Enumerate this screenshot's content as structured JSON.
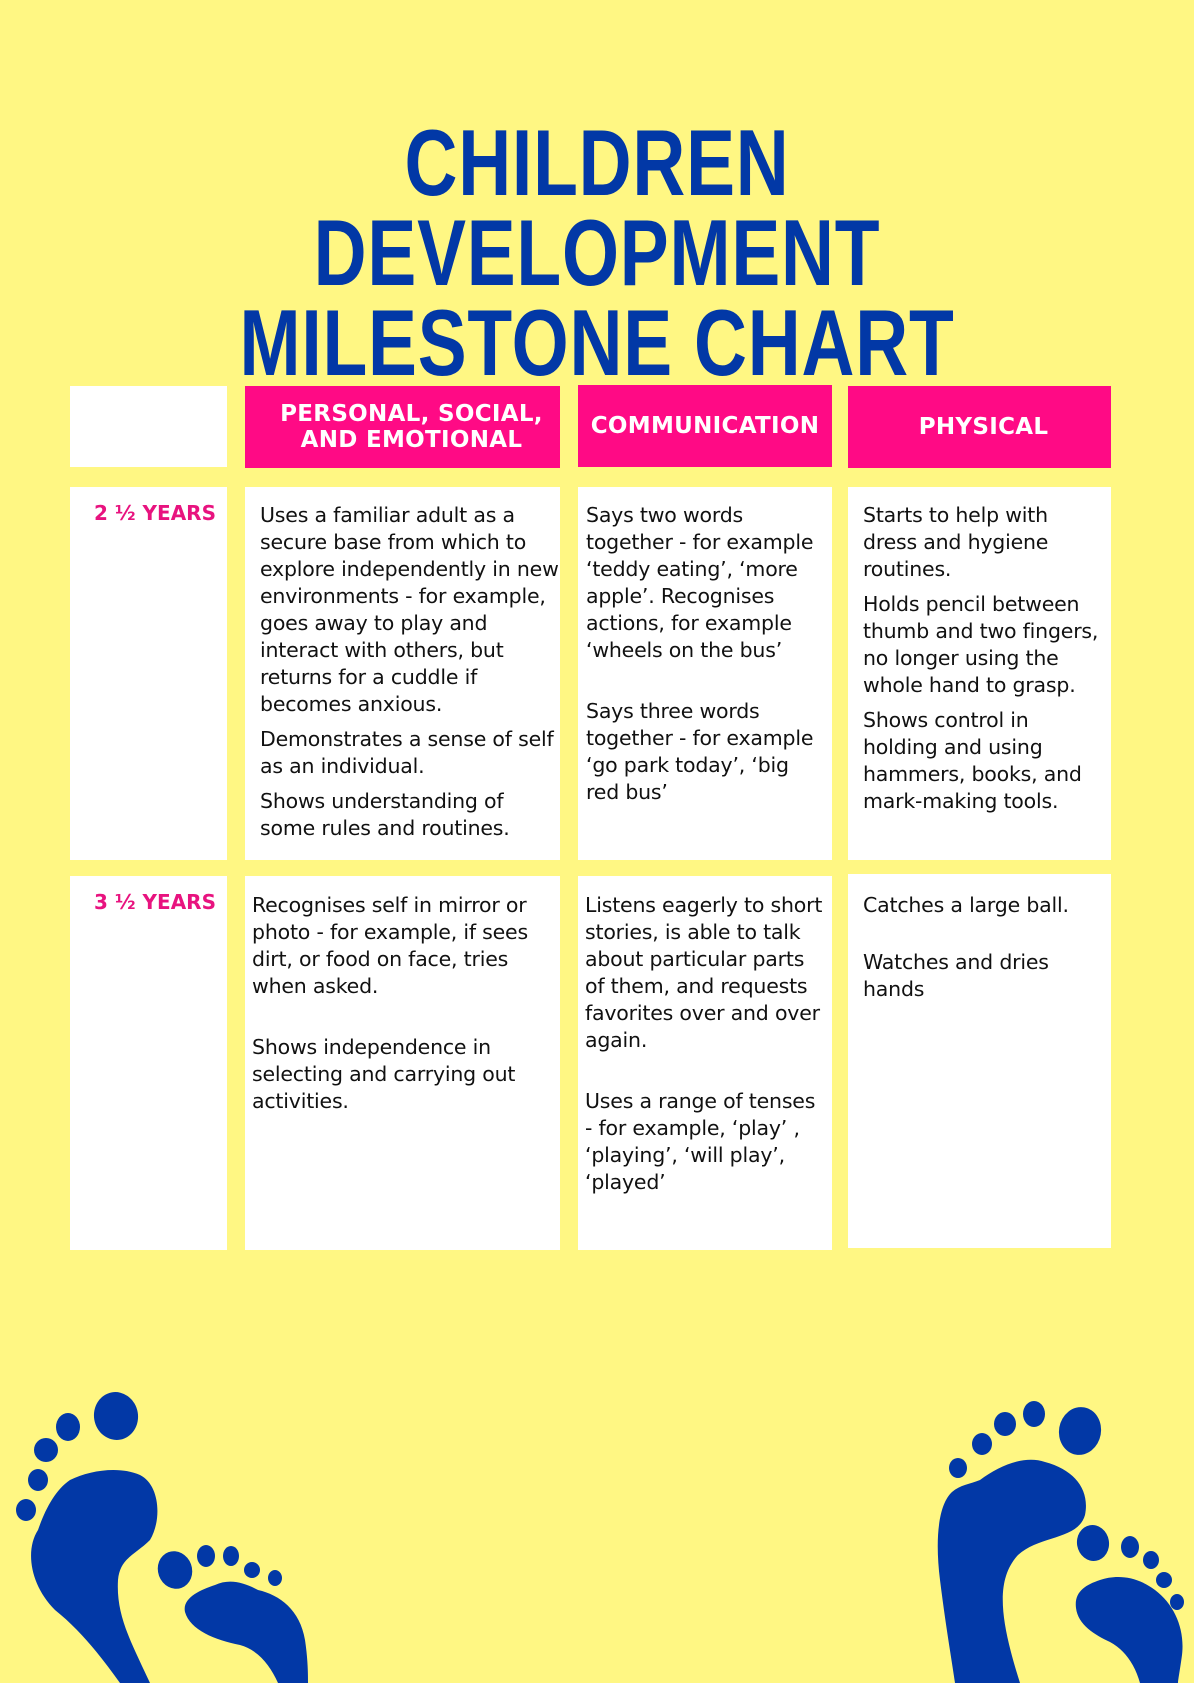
{
  "title": {
    "line1": "CHILDREN DEVELOPMENT",
    "line2": "MILESTONE CHART"
  },
  "colors": {
    "background": "#FFF783",
    "title_blue": "#0238A6",
    "header_pink": "#FF0A85",
    "age_pink": "#E8137F",
    "cell_white": "#FFFFFF"
  },
  "table": {
    "corner_header": "",
    "headers": [
      {
        "line1": "PERSONAL, SOCIAL,",
        "line2": "AND EMOTIONAL"
      },
      {
        "line1": "COMMUNICATION"
      },
      {
        "line1": "PHYSICAL"
      }
    ],
    "rows": [
      {
        "age": "2 ½ YEARS",
        "personal_social_emotional": [
          "Uses a familiar adult as a secure base from which to explore independently in new environments - for example, goes away to play and interact with others, but returns for a cuddle if becomes anxious.",
          "Demonstrates a sense of self as an individual.",
          "Shows understanding of some rules and routines."
        ],
        "communication": [
          "Says two words together - for example ‘teddy eating’, ‘more apple’. Recognises actions, for example ‘wheels on the bus’",
          "Says three words together - for example ‘go park today’, ‘big red bus’"
        ],
        "physical": [
          "Starts to help with dress and hygiene routines.",
          "Holds pencil between thumb and two fingers, no longer using the whole hand to grasp.",
          "Shows control in holding and using hammers, books, and mark-making tools."
        ]
      },
      {
        "age": "3 ½ YEARS",
        "personal_social_emotional": [
          "Recognises self in mirror or photo - for example, if sees dirt, or food on face, tries when asked.",
          "Shows independence in selecting and carrying out activities."
        ],
        "communication": [
          "Listens eagerly to short stories, is able to talk about particular parts of them, and requests favorites over and over again.",
          "Uses a range of tenses - for example, ‘play’ , ‘playing’, ‘will play’, ‘played’"
        ],
        "physical": [
          "Catches a large ball.",
          "Watches and dries hands"
        ]
      }
    ]
  },
  "decorations": {
    "left": "footprints-icon",
    "right": "footprints-icon"
  }
}
